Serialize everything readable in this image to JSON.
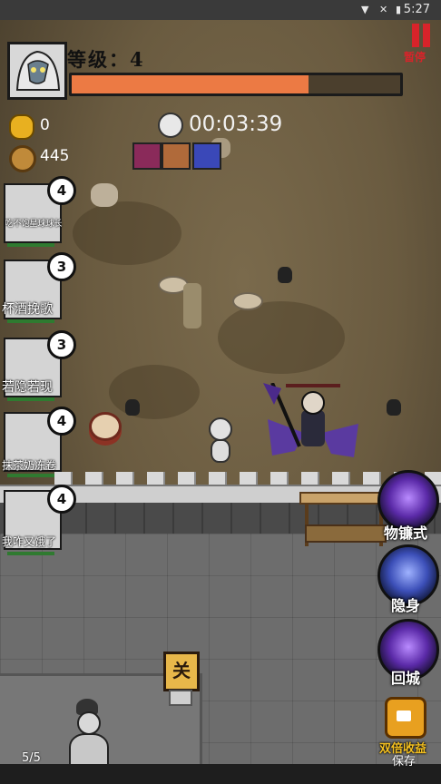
{
  "status_bar": {
    "time": "5:27",
    "icons": [
      "wifi-icon",
      "mute-icon",
      "battery-icon"
    ]
  },
  "hud": {
    "level_label": "等级：4",
    "xp_fraction": 0.72,
    "pause_label": "暂停",
    "gold": "0",
    "coins": "445",
    "timer": "00:03:39",
    "skills": [
      "claw-skill-icon",
      "beast-skill-icon",
      "lightning-skill-icon"
    ]
  },
  "allies": [
    {
      "name": "吃不饱星球球长",
      "level": "4"
    },
    {
      "name": "杯酒挽歌",
      "level": "3"
    },
    {
      "name": "若隐若现",
      "level": "3"
    },
    {
      "name": "抹茶奶冻卷",
      "level": "4"
    },
    {
      "name": "我咋又饿了",
      "level": "4"
    }
  ],
  "actions": [
    {
      "label": "物镰式",
      "icon": "slash-skill-icon"
    },
    {
      "label": "隐身",
      "icon": "stealth-skill-icon"
    },
    {
      "label": "回城",
      "icon": "return-city-icon"
    }
  ],
  "scene": {
    "banner_text": "关",
    "double_reward_label": "双倍收益"
  },
  "footer": {
    "page": "5/5",
    "save": "保存"
  },
  "colors": {
    "xp_fill": "#ec7a44",
    "pause": "#d8232a",
    "ally_hp": "#2f7a30"
  }
}
